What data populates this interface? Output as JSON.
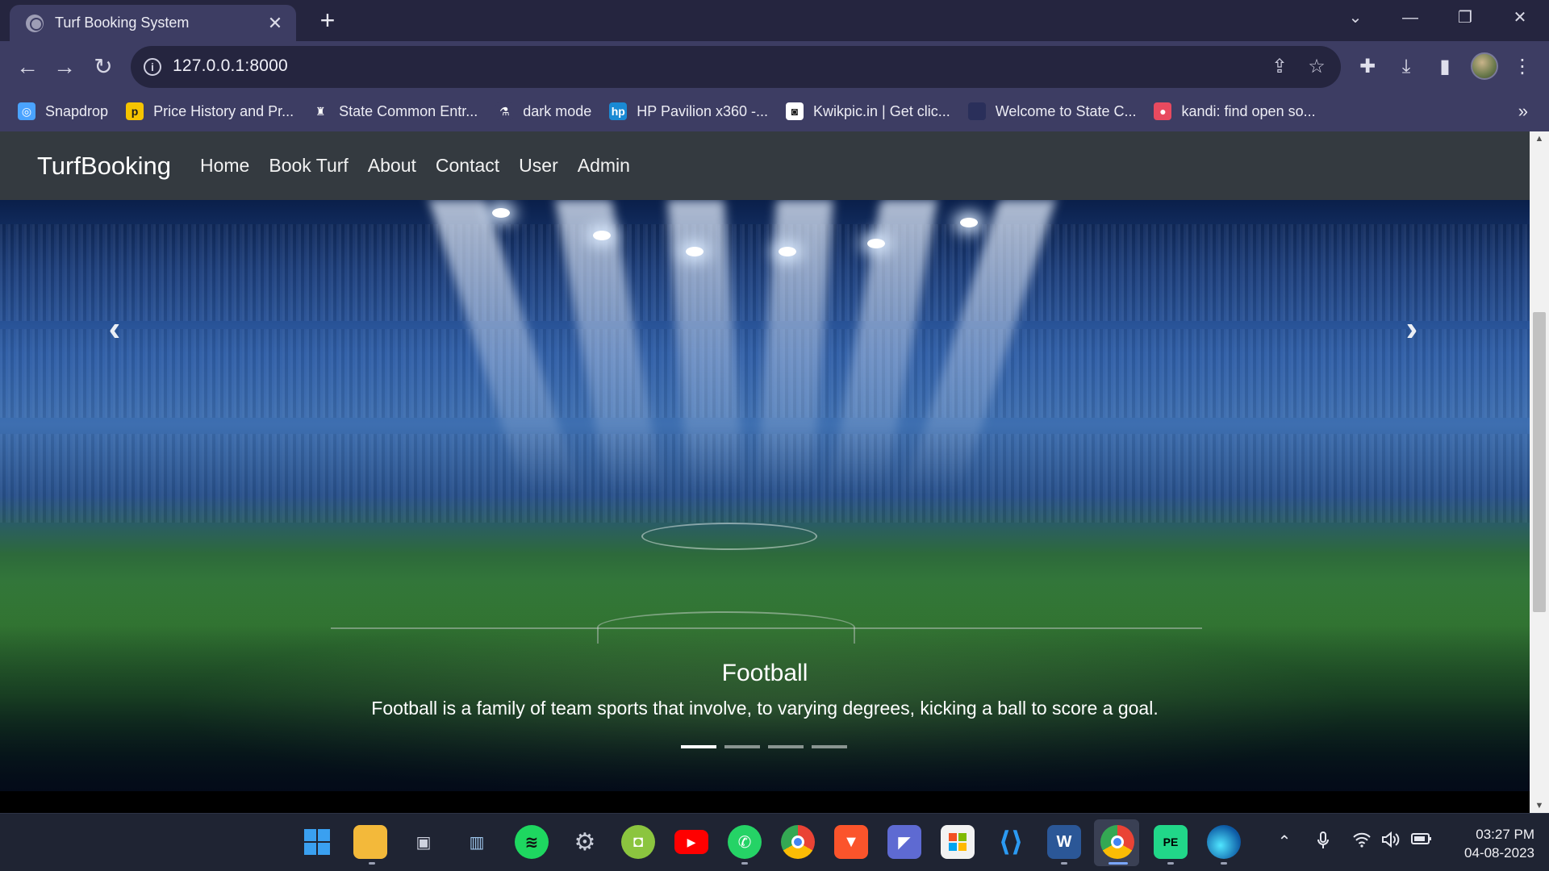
{
  "browser": {
    "tab_title": "Turf Booking System",
    "tab_close": "✕",
    "new_tab": "+",
    "url": "127.0.0.1:8000",
    "window": {
      "chevron": "⌄",
      "minimize": "—",
      "restore": "❐",
      "close": "✕"
    },
    "bookmarks": [
      {
        "label": "Snapdrop",
        "icon": "snapdrop-icon",
        "glyph": "◎",
        "color": "#4aa3ff"
      },
      {
        "label": "Price History and Pr...",
        "icon": "pricehistory-icon",
        "glyph": "p",
        "color": "#f5c400"
      },
      {
        "label": "State Common Entr...",
        "icon": "emblem-icon",
        "glyph": "♜",
        "color": "#3d3d63"
      },
      {
        "label": "dark mode",
        "icon": "flask-icon",
        "glyph": "⚗",
        "color": "#3d3d63"
      },
      {
        "label": "HP Pavilion x360 -...",
        "icon": "hp-icon",
        "glyph": "hp",
        "color": "#1a8ad4"
      },
      {
        "label": "Kwikpic.in | Get clic...",
        "icon": "kwikpic-icon",
        "glyph": "◙",
        "color": "#ffffff"
      },
      {
        "label": "Welcome to State C...",
        "icon": "state-icon",
        "glyph": "",
        "color": "#2a2f5a"
      },
      {
        "label": "kandi: find open so...",
        "icon": "kandi-icon",
        "glyph": "●",
        "color": "#e84a5f"
      }
    ],
    "bookmarks_more": "»"
  },
  "site": {
    "brand": "TurfBooking",
    "nav": [
      "Home",
      "Book Turf",
      "About",
      "Contact",
      "User",
      "Admin"
    ],
    "carousel": {
      "prev": "‹",
      "next": "›",
      "caption_title": "Football",
      "caption_text": "Football is a family of team sports that involve, to varying degrees, kicking a ball to score a goal.",
      "slide_count": 4,
      "active_slide": 1
    }
  },
  "taskbar": {
    "apps": [
      "start-icon",
      "file-explorer-icon",
      "terminal-icon",
      "recycle-bin-icon",
      "spotify-icon",
      "settings-icon",
      "android-icon",
      "youtube-icon",
      "whatsapp-icon",
      "chrome-icon",
      "brave-icon",
      "linear-icon",
      "microsoft-store-icon",
      "vscode-icon",
      "word-icon",
      "chrome-active-icon",
      "pycharm-icon",
      "edge-icon"
    ],
    "tray": {
      "chevron": "⌃",
      "mic": "🎙",
      "wifi": "◠",
      "volume": "🔊",
      "battery": "▭"
    },
    "time": "03:27 PM",
    "date": "04-08-2023"
  }
}
